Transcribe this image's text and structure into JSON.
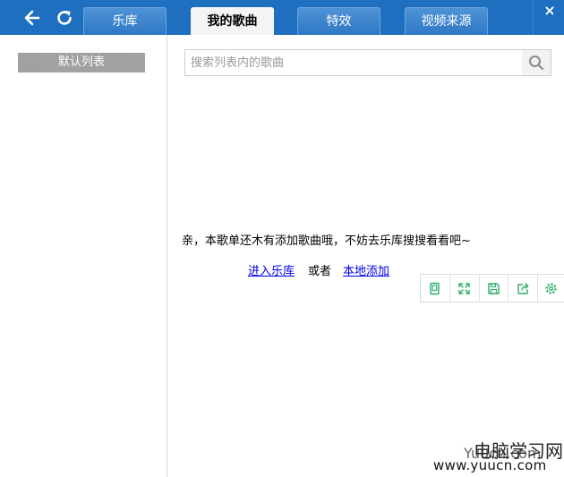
{
  "header": {
    "tabs": [
      {
        "label": "乐库",
        "active": false
      },
      {
        "label": "我的歌曲",
        "active": true
      },
      {
        "label": "特效",
        "active": false
      },
      {
        "label": "视频来源",
        "active": false
      }
    ],
    "close_label": "×",
    "icons": {
      "back": "arrow-left-icon",
      "refresh": "refresh-icon",
      "close": "close-icon"
    }
  },
  "sidebar": {
    "items": [
      {
        "label": "默认列表"
      }
    ]
  },
  "search": {
    "value": "",
    "placeholder": "搜索列表内的歌曲",
    "icon": "search-icon"
  },
  "empty_state": {
    "message": "亲，本歌单还木有添加歌曲哦，不妨去乐库搜搜看看吧~",
    "link_library": "进入乐库",
    "or_text": "或者",
    "link_local": "本地添加"
  },
  "toolbar": {
    "icons": [
      "mini-mode-icon",
      "fullscreen-icon",
      "save-icon",
      "share-icon",
      "settings-icon"
    ]
  },
  "watermark": {
    "cn": "电脑学习网",
    "en": "Yuucn.com",
    "url": "www.yuucn.com"
  },
  "colors": {
    "header_bg": "#1f6fc0",
    "tab_bg": "#3a80cc",
    "tab_active_bg": "#f4f4f4",
    "link": "#0000ee",
    "toolbar_icon": "#2fae6a"
  }
}
